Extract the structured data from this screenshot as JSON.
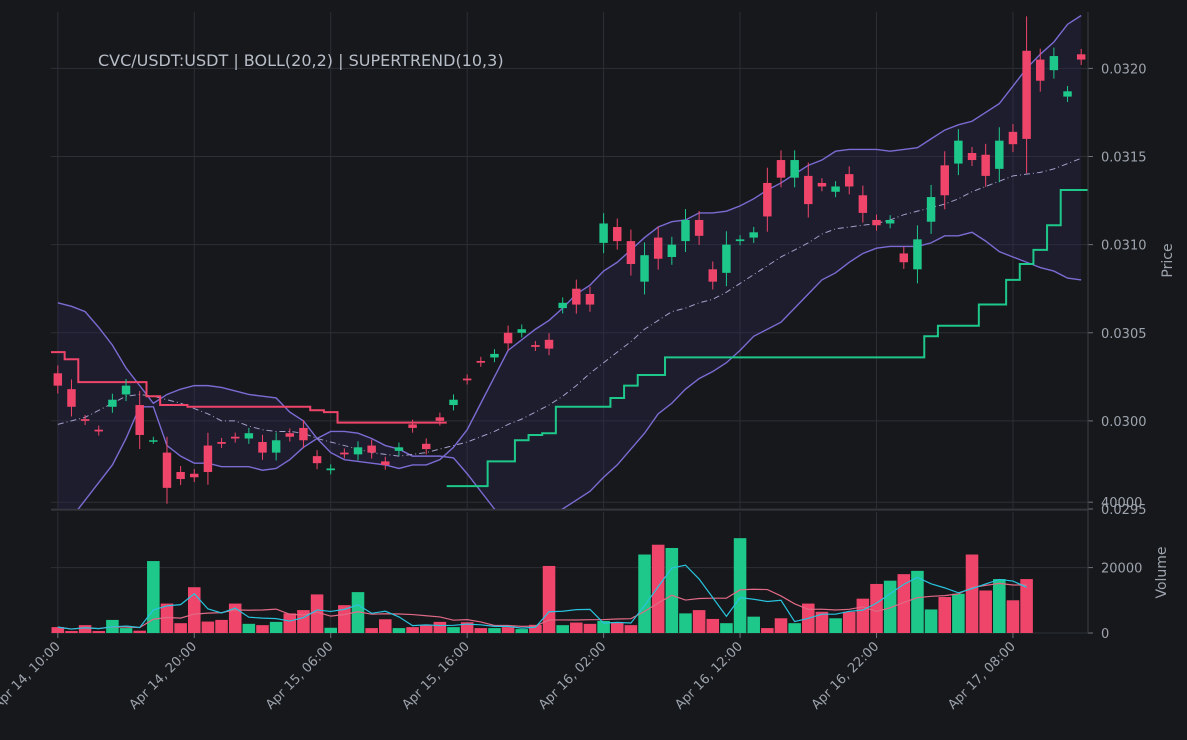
{
  "chart_data": {
    "type": "candlestick",
    "title": "CVC/USDT:USDT | BOLL(20,2) | SUPERTREND(10,3)",
    "price_axis": {
      "label": "Price",
      "ticks": [
        0.0295,
        0.03,
        0.0305,
        0.031,
        0.0315,
        0.032
      ],
      "tick_labels": [
        "0.0295",
        "0.0300",
        "0.0305",
        "0.0310",
        "0.0315",
        "0.0320"
      ],
      "ylim": [
        0.0295,
        0.03232
      ]
    },
    "volume_axis": {
      "label": "Volume",
      "ticks": [
        0,
        20000,
        40000
      ],
      "tick_labels": [
        "0",
        "20000",
        "40000"
      ],
      "ylim": [
        0,
        37000
      ]
    },
    "x_axis": {
      "tick_index": [
        0,
        10,
        20,
        30,
        40,
        50,
        60,
        70
      ],
      "tick_labels": [
        "Apr 14, 10:00",
        "Apr 14, 20:00",
        "Apr 15, 06:00",
        "Apr 15, 16:00",
        "Apr 16, 02:00",
        "Apr 16, 12:00",
        "Apr 16, 22:00",
        "Apr 17, 08:00"
      ]
    },
    "candles": {
      "open": [
        0.03027,
        0.03018,
        0.03001,
        0.02995,
        0.03008,
        0.03015,
        0.03009,
        0.02989,
        0.02982,
        0.02971,
        0.0297,
        0.02986,
        0.02988,
        0.02991,
        0.0299,
        0.02988,
        0.02982,
        0.02993,
        0.02996,
        0.0298,
        0.02972,
        0.02982,
        0.02981,
        0.02986,
        0.02977,
        0.02983,
        0.02998,
        0.02987,
        0.03002,
        0.03009,
        0.03024,
        0.03034,
        0.03036,
        0.0305,
        0.0305,
        0.03043,
        0.03046,
        0.03064,
        0.03075,
        0.03072,
        0.03101,
        0.0311,
        0.03102,
        0.03079,
        0.03104,
        0.03093,
        0.03102,
        0.03114,
        0.03086,
        0.03084,
        0.03102,
        0.03104,
        0.03135,
        0.03148,
        0.03138,
        0.03139,
        0.03135,
        0.0313,
        0.0314,
        0.03128,
        0.03114,
        0.03112,
        0.03095,
        0.03086,
        0.03113,
        0.03145,
        0.03146,
        0.03152,
        0.03151,
        0.03143,
        0.03164,
        0.0321,
        0.03205,
        0.03199,
        0.03184,
        0.03208
      ],
      "close": [
        0.0302,
        0.03008,
        0.03,
        0.02994,
        0.03012,
        0.0302,
        0.02992,
        0.02989,
        0.02962,
        0.02967,
        0.02968,
        0.02971,
        0.02987,
        0.0299,
        0.02993,
        0.02982,
        0.02989,
        0.02991,
        0.02989,
        0.02976,
        0.02973,
        0.02981,
        0.02985,
        0.02982,
        0.02975,
        0.02985,
        0.02996,
        0.02984,
        0.03,
        0.03012,
        0.03023,
        0.03033,
        0.03038,
        0.03044,
        0.03052,
        0.03042,
        0.03041,
        0.03067,
        0.03066,
        0.03066,
        0.03112,
        0.03102,
        0.03089,
        0.03094,
        0.03092,
        0.031,
        0.03114,
        0.03105,
        0.03079,
        0.031,
        0.03103,
        0.03107,
        0.03116,
        0.03138,
        0.03148,
        0.03123,
        0.03133,
        0.03133,
        0.03133,
        0.03118,
        0.03111,
        0.03114,
        0.0309,
        0.03103,
        0.03127,
        0.03128,
        0.03159,
        0.03148,
        0.03139,
        0.03159,
        0.03157,
        0.0316,
        0.03193,
        0.03207,
        0.03187,
        0.03205
      ]
    },
    "volume": [
      1800,
      600,
      2400,
      600,
      4000,
      1500,
      700,
      22000,
      9000,
      3000,
      14000,
      3500,
      4000,
      9000,
      2800,
      2400,
      3400,
      6000,
      7000,
      11800,
      1600,
      8500,
      12500,
      1500,
      4200,
      1500,
      1800,
      2400,
      3400,
      1800,
      3300,
      1500,
      1500,
      1800,
      1200,
      2500,
      20500,
      2400,
      3200,
      2800,
      3700,
      3300,
      2400,
      24000,
      27000,
      26000,
      6000,
      7000,
      4300,
      3000,
      29000,
      5000,
      1500,
      4500,
      3000,
      9000,
      6500,
      4500,
      6500,
      10500,
      15000,
      16000,
      18000,
      19000,
      7200,
      11000,
      12000,
      24000,
      13000,
      16500,
      10000,
      16500
    ],
    "boll_upper": [
      0.03067,
      0.03065,
      0.03062,
      0.03053,
      0.03043,
      0.0303,
      0.0302,
      0.0301,
      0.03015,
      0.03018,
      0.0302,
      0.0302,
      0.03019,
      0.03017,
      0.03015,
      0.03014,
      0.03013,
      0.03005,
      0.03,
      0.0299,
      0.02982,
      0.02978,
      0.02977,
      0.02976,
      0.02975,
      0.02973,
      0.02975,
      0.02975,
      0.02978,
      0.02985,
      0.02995,
      0.0301,
      0.03025,
      0.0304,
      0.03046,
      0.03052,
      0.03057,
      0.03064,
      0.03072,
      0.03077,
      0.03085,
      0.0309,
      0.03097,
      0.03104,
      0.0311,
      0.03113,
      0.03114,
      0.03118,
      0.03118,
      0.03119,
      0.03122,
      0.03126,
      0.03131,
      0.03135,
      0.0314,
      0.03145,
      0.03148,
      0.03153,
      0.03154,
      0.03154,
      0.03154,
      0.03153,
      0.03154,
      0.03155,
      0.0316,
      0.03165,
      0.03168,
      0.0317,
      0.03175,
      0.0318,
      0.0319,
      0.032,
      0.03208,
      0.03215,
      0.03225,
      0.0323
    ],
    "boll_mid": [
      0.02998,
      0.03,
      0.03002,
      0.03006,
      0.0301,
      0.03014,
      0.03015,
      0.03014,
      0.03012,
      0.0301,
      0.03007,
      0.03004,
      0.03,
      0.03,
      0.02997,
      0.02995,
      0.02994,
      0.02994,
      0.02993,
      0.0299,
      0.02988,
      0.02986,
      0.02984,
      0.02982,
      0.02981,
      0.0298,
      0.02981,
      0.02982,
      0.02984,
      0.02986,
      0.02988,
      0.02991,
      0.02994,
      0.02998,
      0.03001,
      0.03005,
      0.03009,
      0.03014,
      0.0302,
      0.03027,
      0.03033,
      0.03039,
      0.03045,
      0.03052,
      0.03057,
      0.03062,
      0.03064,
      0.03067,
      0.03069,
      0.03073,
      0.03078,
      0.03083,
      0.03088,
      0.03093,
      0.03097,
      0.03101,
      0.03106,
      0.03109,
      0.0311,
      0.03111,
      0.03112,
      0.03114,
      0.03117,
      0.03119,
      0.03121,
      0.03123,
      0.03126,
      0.0313,
      0.03133,
      0.03136,
      0.03139,
      0.0314,
      0.03141,
      0.03143,
      0.03146,
      0.03149
    ],
    "boll_lower": [
      0.0294,
      0.02945,
      0.02955,
      0.02965,
      0.02975,
      0.0299,
      0.03008,
      0.03008,
      0.02986,
      0.0298,
      0.02976,
      0.02976,
      0.02974,
      0.02974,
      0.02974,
      0.02972,
      0.02973,
      0.02978,
      0.02985,
      0.0299,
      0.02994,
      0.02994,
      0.02993,
      0.0299,
      0.02986,
      0.02984,
      0.0298,
      0.0298,
      0.0298,
      0.02979,
      0.0297,
      0.0296,
      0.0295,
      0.02945,
      0.02942,
      0.02944,
      0.02947,
      0.0295,
      0.02955,
      0.0296,
      0.02968,
      0.02975,
      0.02984,
      0.02993,
      0.03004,
      0.0301,
      0.03018,
      0.03024,
      0.03028,
      0.03033,
      0.0304,
      0.03048,
      0.03052,
      0.03056,
      0.03064,
      0.03072,
      0.0308,
      0.03084,
      0.0309,
      0.03095,
      0.03098,
      0.03099,
      0.03099,
      0.03099,
      0.03101,
      0.03105,
      0.03105,
      0.03107,
      0.03102,
      0.03096,
      0.03093,
      0.0309,
      0.03087,
      0.03085,
      0.03081,
      0.0308
    ],
    "supertrend": [
      0.03039,
      0.03035,
      0.03022,
      0.03022,
      0.03022,
      0.03022,
      0.03022,
      0.03014,
      0.03009,
      0.03009,
      0.03008,
      0.03008,
      0.03008,
      0.03008,
      0.03008,
      0.03008,
      0.03008,
      0.03008,
      0.03008,
      0.03006,
      0.03005,
      0.02999,
      0.02999,
      0.02999,
      0.02999,
      0.02999,
      0.02999,
      0.02999,
      0.02999,
      0.02963,
      0.02963,
      0.02963,
      0.02977,
      0.02977,
      0.02989,
      0.02992,
      0.02993,
      0.03008,
      0.03008,
      0.03008,
      0.03008,
      0.03013,
      0.0302,
      0.03026,
      0.03026,
      0.03036,
      0.03036,
      0.03036,
      0.03036,
      0.03036,
      0.03036,
      0.03036,
      0.03036,
      0.03036,
      0.03036,
      0.03036,
      0.03036,
      0.03036,
      0.03036,
      0.03036,
      0.03036,
      0.03036,
      0.03036,
      0.03036,
      0.03048,
      0.03054,
      0.03054,
      0.03054,
      0.03066,
      0.03066,
      0.0308,
      0.03089,
      0.03097,
      0.03111,
      0.03131,
      0.03131
    ],
    "supertrend_bull_from": 29,
    "colors": {
      "up": "#1ec88a",
      "down": "#f0456a",
      "boll_band": "#7b6bd2",
      "boll_mid": "#a39ec9",
      "supertrend_bear": "#f0456a",
      "supertrend_bull": "#1ec88a",
      "vol_ma_pink": "#e06a86",
      "vol_ma_cyan": "#29c3de",
      "grid": "#2c2f35",
      "axis": "#6e737b",
      "text": "#9ea4ad",
      "background": "#16181c"
    }
  }
}
